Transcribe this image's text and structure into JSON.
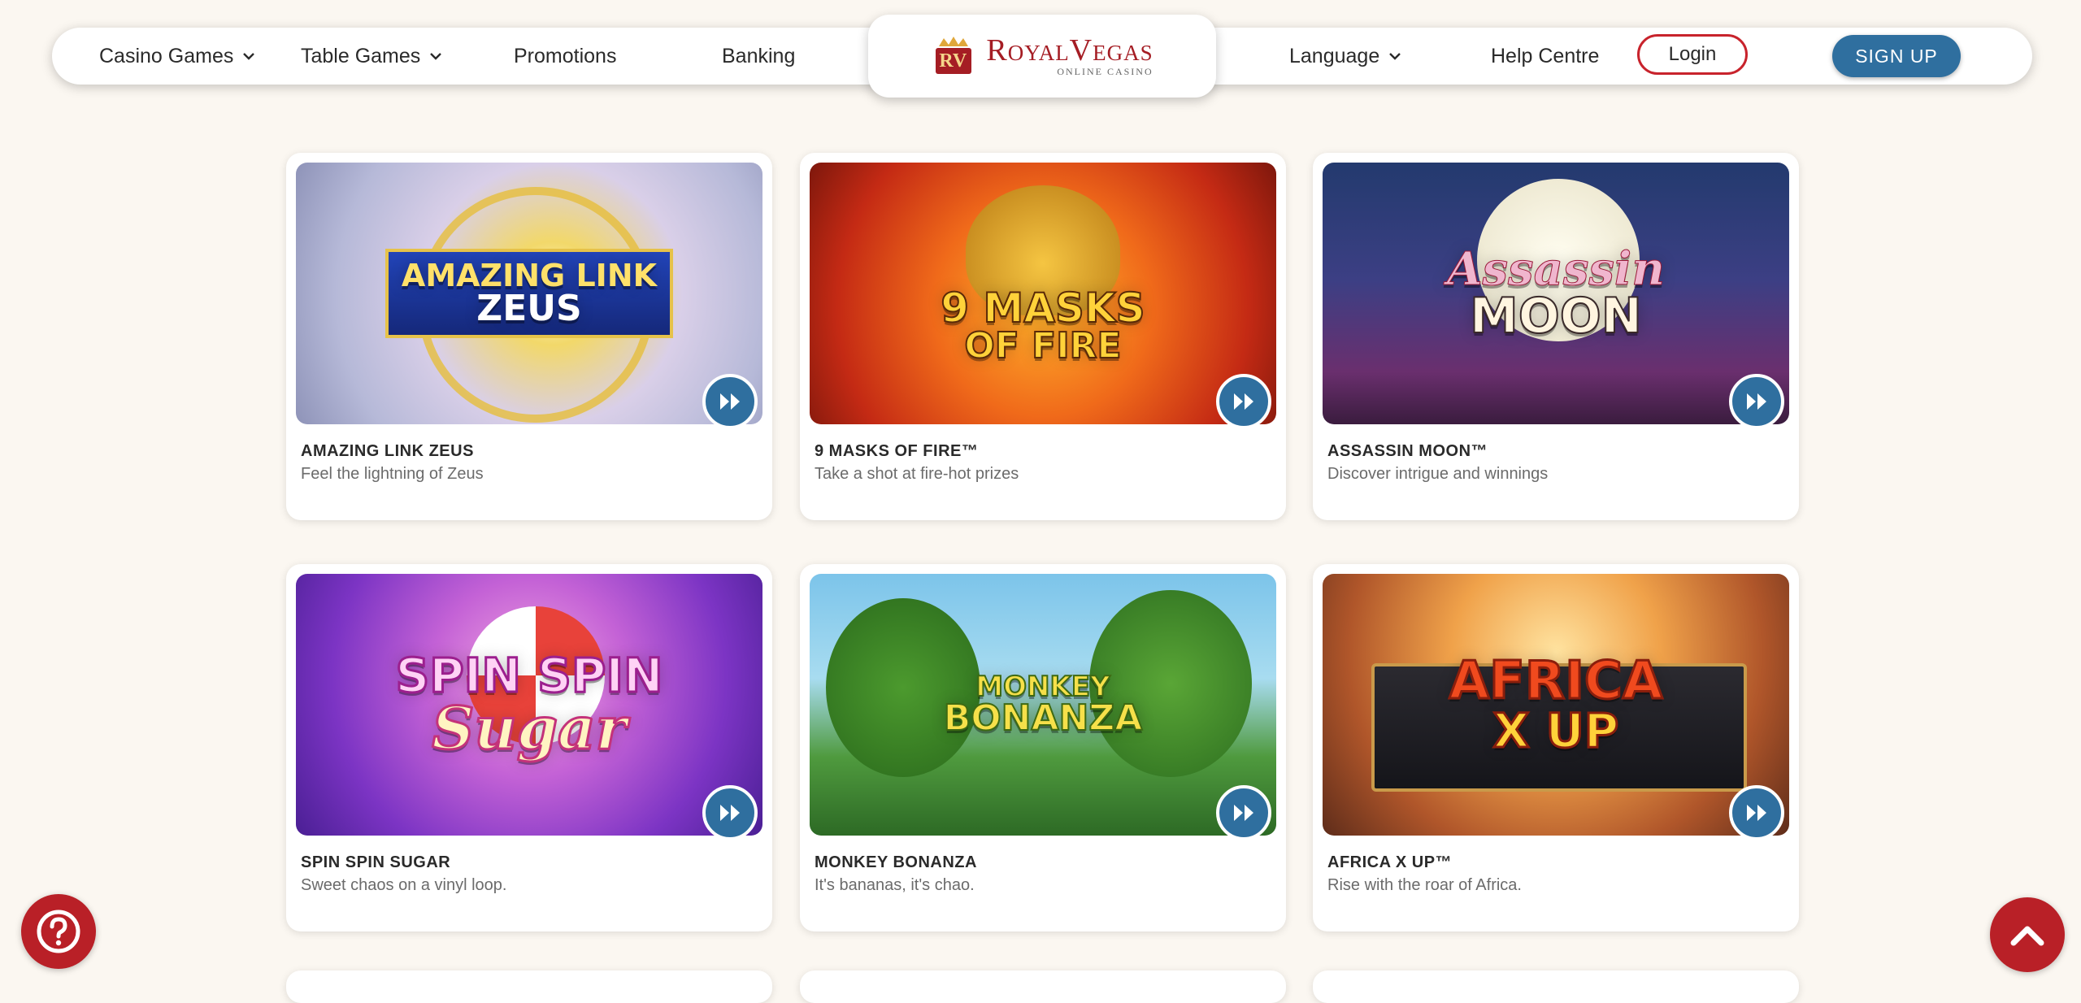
{
  "nav": {
    "casino_games": "Casino Games",
    "table_games": "Table Games",
    "promotions": "Promotions",
    "banking": "Banking",
    "language": "Language",
    "help_centre": "Help Centre",
    "login": "Login",
    "sign_up": "SIGN UP"
  },
  "logo": {
    "monogram": "RV",
    "name": "RoyalVegas",
    "subtitle": "ONLINE CASINO"
  },
  "games": [
    {
      "title": "AMAZING LINK ZEUS",
      "description": "Feel the lightning of Zeus",
      "art_line1": "AMAZING LINK",
      "art_line2": "ZEUS"
    },
    {
      "title": "9 MASKS OF FIRE™",
      "description": "Take a shot at fire-hot prizes",
      "art_line1": "9 MASKS",
      "art_line2": "OF FIRE"
    },
    {
      "title": "ASSASSIN MOON™",
      "description": "Discover intrigue and winnings",
      "art_line1": "Assassin",
      "art_line2": "MOON"
    },
    {
      "title": "SPIN SPIN SUGAR",
      "description": "Sweet chaos on a vinyl loop.",
      "art_line1": "SPIN SPIN",
      "art_line2": "Sugar"
    },
    {
      "title": "MONKEY BONANZA",
      "description": "It's bananas, it's chao.",
      "art_line1": "MONKEY",
      "art_line2": "BONANZA"
    },
    {
      "title": "AFRICA X UP™",
      "description": "Rise with the roar of Africa.",
      "art_line1": "AFRICA",
      "art_line2": "X UP"
    }
  ],
  "colors": {
    "brand_red": "#b92027",
    "play_blue": "#2f6f9f",
    "background": "#fbf7f1"
  },
  "icons": {
    "help": "question-circle-icon",
    "back_to_top": "chevron-up-icon",
    "play": "fast-forward-icon"
  }
}
